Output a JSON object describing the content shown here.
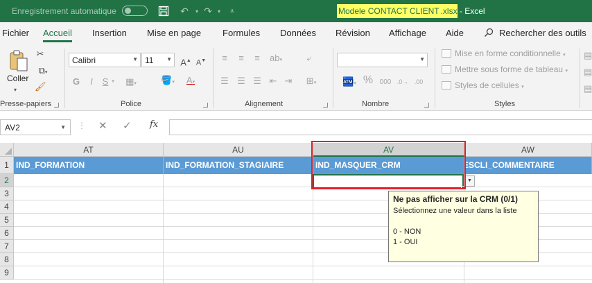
{
  "title_bar": {
    "autosave_label": "Enregistrement automatique",
    "doc_name_highlighted": "Modele CONTACT CLIENT",
    "doc_ext": ".xlsx",
    "app_suffix": " - Excel",
    "accent_color": "#217346"
  },
  "menu": {
    "tabs": [
      {
        "label": "Fichier"
      },
      {
        "label": "Accueil"
      },
      {
        "label": "Insertion"
      },
      {
        "label": "Mise en page"
      },
      {
        "label": "Formules"
      },
      {
        "label": "Données"
      },
      {
        "label": "Révision"
      },
      {
        "label": "Affichage"
      },
      {
        "label": "Aide"
      }
    ],
    "active_tab": "Accueil",
    "search_label": "Rechercher des outils"
  },
  "ribbon": {
    "clipboard": {
      "paste_label": "Coller",
      "group_label": "Presse-papiers"
    },
    "font": {
      "font_name": "Calibri",
      "font_size": "11",
      "bold": "G",
      "italic": "I",
      "underline": "S",
      "group_label": "Police"
    },
    "alignment": {
      "group_label": "Alignement"
    },
    "number": {
      "format_value": "",
      "percent": "%",
      "thousands": "000",
      "group_label": "Nombre"
    },
    "styles": {
      "conditional": "Mise en forme conditionnelle",
      "table": "Mettre sous forme de tableau",
      "cell_styles": "Styles de cellules",
      "group_label": "Styles"
    }
  },
  "formula_bar": {
    "name_box": "AV2",
    "fx_label": "fx",
    "formula_value": ""
  },
  "sheet": {
    "columns": [
      "AT",
      "AU",
      "AV",
      "AW"
    ],
    "selected_column": "AV",
    "rows": [
      "1",
      "2",
      "3",
      "4",
      "5",
      "6",
      "7",
      "8",
      "9"
    ],
    "selected_row": "2",
    "header_row": [
      "IND_FORMATION",
      "IND_FORMATION_STAGIAIRE",
      "IND_MASQUER_CRM",
      "ESCLI_COMMENTAIRE"
    ],
    "header_fill": "#5b9bd5"
  },
  "validation_tooltip": {
    "title": "Ne pas afficher sur la CRM (0/1)",
    "line1": "Sélectionnez une valeur dans la liste",
    "option1": "0 - NON",
    "option2": "1 - OUI"
  },
  "highlight_color": "#d9232a"
}
